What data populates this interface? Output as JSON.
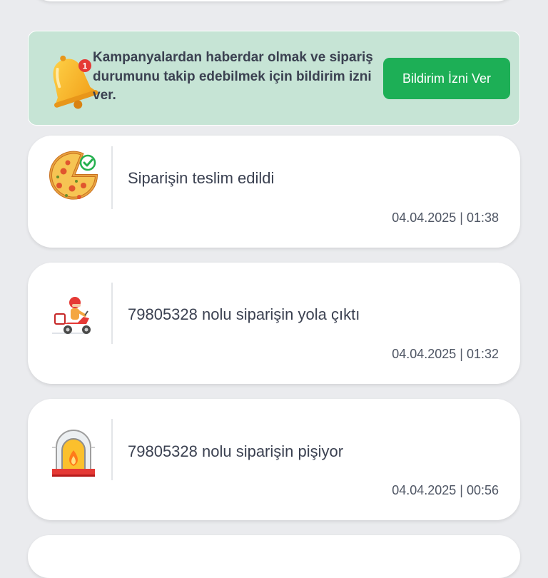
{
  "banner": {
    "text": "Kampanyalardan haberdar olmak ve sipariş durumunu takip edebilmek için bildirim izni ver.",
    "button_label": "Bildirim İzni Ver",
    "badge_count": "1",
    "icon": "bell-icon"
  },
  "notifications": [
    {
      "message": "Siparişin teslim edildi",
      "time": "04.04.2025 | 01:38",
      "icon": "pizza-delivered-icon"
    },
    {
      "message": "79805328 nolu siparişin yola çıktı",
      "time": "04.04.2025 | 01:32",
      "icon": "scooter-courier-icon"
    },
    {
      "message": "79805328 nolu siparişin pişiyor",
      "time": "04.04.2025 | 00:56",
      "icon": "pizza-oven-icon"
    }
  ],
  "colors": {
    "page_background": "#eaebee",
    "banner_background": "#c6e4d5",
    "accent_green": "#1daf56",
    "text_dark": "#3b4151",
    "badge_red": "#e53935"
  }
}
